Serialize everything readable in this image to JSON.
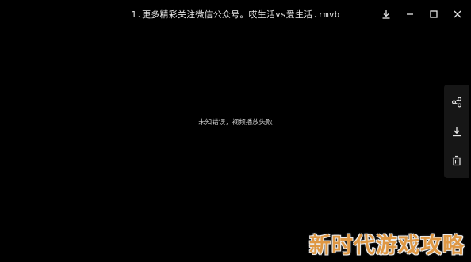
{
  "window": {
    "title": "1.更多精彩关注微信公众号。哎生活vs爱生活.rmvb",
    "controls": {
      "download_icon": "download-icon",
      "minimize_icon": "minimize-icon",
      "maximize_icon": "maximize-icon",
      "close_icon": "close-icon"
    }
  },
  "player": {
    "error_message": "未知错误，视频播放失败",
    "background_color": "#000000"
  },
  "side_panel": {
    "items": [
      {
        "icon": "share-icon"
      },
      {
        "icon": "download-icon"
      },
      {
        "icon": "trash-icon"
      }
    ]
  },
  "watermark": {
    "text": "新时代游戏攻略",
    "color": "#f2a54a"
  }
}
